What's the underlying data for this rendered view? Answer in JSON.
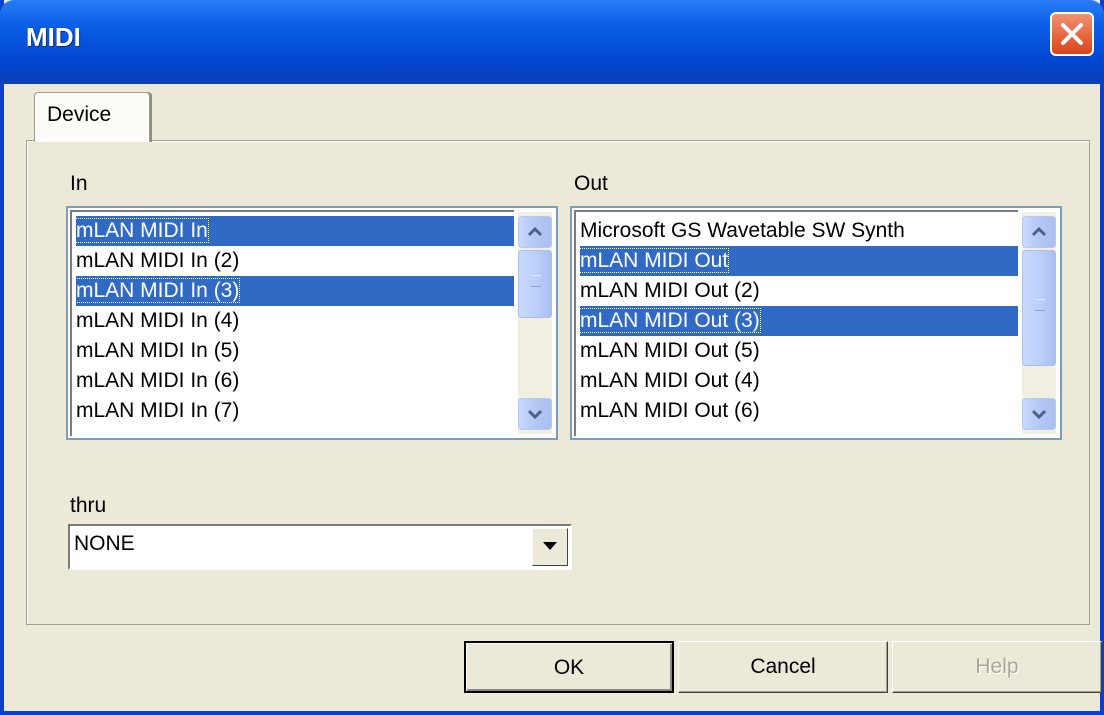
{
  "window": {
    "title": "MIDI"
  },
  "tabs": [
    {
      "label": "Device"
    }
  ],
  "in": {
    "label": "In",
    "items": [
      {
        "label": "mLAN MIDI In",
        "selected": true
      },
      {
        "label": "mLAN MIDI In (2)",
        "selected": false
      },
      {
        "label": "mLAN MIDI In (3)",
        "selected": true
      },
      {
        "label": "mLAN MIDI In (4)",
        "selected": false
      },
      {
        "label": "mLAN MIDI In (5)",
        "selected": false
      },
      {
        "label": "mLAN MIDI In (6)",
        "selected": false
      },
      {
        "label": "mLAN MIDI In (7)",
        "selected": false
      }
    ]
  },
  "out": {
    "label": "Out",
    "items": [
      {
        "label": "Microsoft GS Wavetable SW Synth",
        "selected": false
      },
      {
        "label": "mLAN MIDI Out",
        "selected": true
      },
      {
        "label": "mLAN MIDI Out (2)",
        "selected": false
      },
      {
        "label": "mLAN MIDI Out (3)",
        "selected": true
      },
      {
        "label": "mLAN MIDI Out (5)",
        "selected": false
      },
      {
        "label": "mLAN MIDI Out (4)",
        "selected": false
      },
      {
        "label": "mLAN MIDI Out (6)",
        "selected": false
      }
    ]
  },
  "thru": {
    "label": "thru",
    "value": "NONE"
  },
  "buttons": {
    "ok": "OK",
    "cancel": "Cancel",
    "help": "Help"
  },
  "colors": {
    "selection": "#316ac5",
    "titlebar": "#0a5ee6",
    "face": "#ece9d8"
  }
}
